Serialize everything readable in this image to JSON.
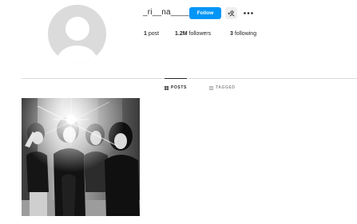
{
  "profile": {
    "username": "_ri__na____",
    "follow_label": "Follow"
  },
  "icons": {
    "suggest": "person-add-icon",
    "more": "more-horizontal-icon",
    "posts_tab": "grid-icon",
    "tagged_tab": "tagged-icon"
  },
  "stats": {
    "posts_count": "1",
    "posts_label": "post",
    "followers_count": "1.2M",
    "followers_label": "followers",
    "following_count": "3",
    "following_label": "following"
  },
  "tabs": [
    {
      "label": "POSTS",
      "active": true
    },
    {
      "label": "TAGGED",
      "active": false
    }
  ],
  "colors": {
    "accent": "#0095f6",
    "text": "#262626",
    "muted": "#8e8e8e",
    "divider": "#dbdbdb"
  }
}
